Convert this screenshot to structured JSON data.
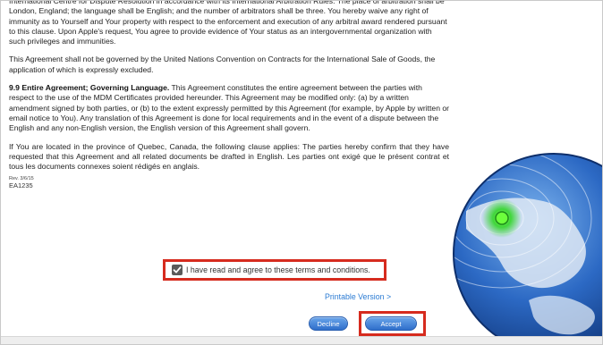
{
  "agreement": {
    "paragraphs": [
      {
        "id": "arbitration",
        "text": "International Centre for Dispute Resolution in accordance with its International Arbitration Rules. The place of arbitration shall be London, England; the language shall be English; and the number of arbitrators shall be three. You hereby waive any right of immunity as to Yourself and Your property with respect to the enforcement and execution of any arbitral award rendered pursuant to this clause. Upon Apple's request, You agree to provide evidence of Your status as an intergovernmental organization with such privileges and immunities."
      },
      {
        "id": "un-convention",
        "text": "This Agreement shall not be governed by the United Nations Convention on Contracts for the International Sale of Goods, the application of which is expressly excluded."
      },
      {
        "id": "entire-agreement",
        "heading": "9.9  Entire Agreement; Governing Language.",
        "text": " This Agreement constitutes the entire agreement between the parties with respect to the use of the MDM Certificates provided hereunder. This Agreement may be modified only: (a) by a written amendment signed by both parties, or (b) to the extent expressly permitted by this Agreement (for example, by Apple by written or email notice to You). Any translation of this Agreement is done for local requirements and in the event of a dispute between the English and any non-English version, the English version of this Agreement shall govern."
      },
      {
        "id": "quebec",
        "text": "If You are located in the province of Quebec, Canada, the following clause applies: The parties hereby confirm that they have requested that this Agreement and all related documents be drafted in English. Les parties ont exigé que le présent contrat et tous les documents connexes soient rédigés en anglais."
      }
    ],
    "rev": "Rev. 3/6/15",
    "code": "EA1235"
  },
  "agree": {
    "checked": true,
    "label": "I have read and agree to these terms and conditions."
  },
  "links": {
    "printable": "Printable Version >"
  },
  "buttons": {
    "decline": "Decline",
    "accept": "Accept"
  },
  "colors": {
    "highlight": "#d62b1e",
    "link": "#2b7bd3",
    "button": "#3a7ad6"
  }
}
